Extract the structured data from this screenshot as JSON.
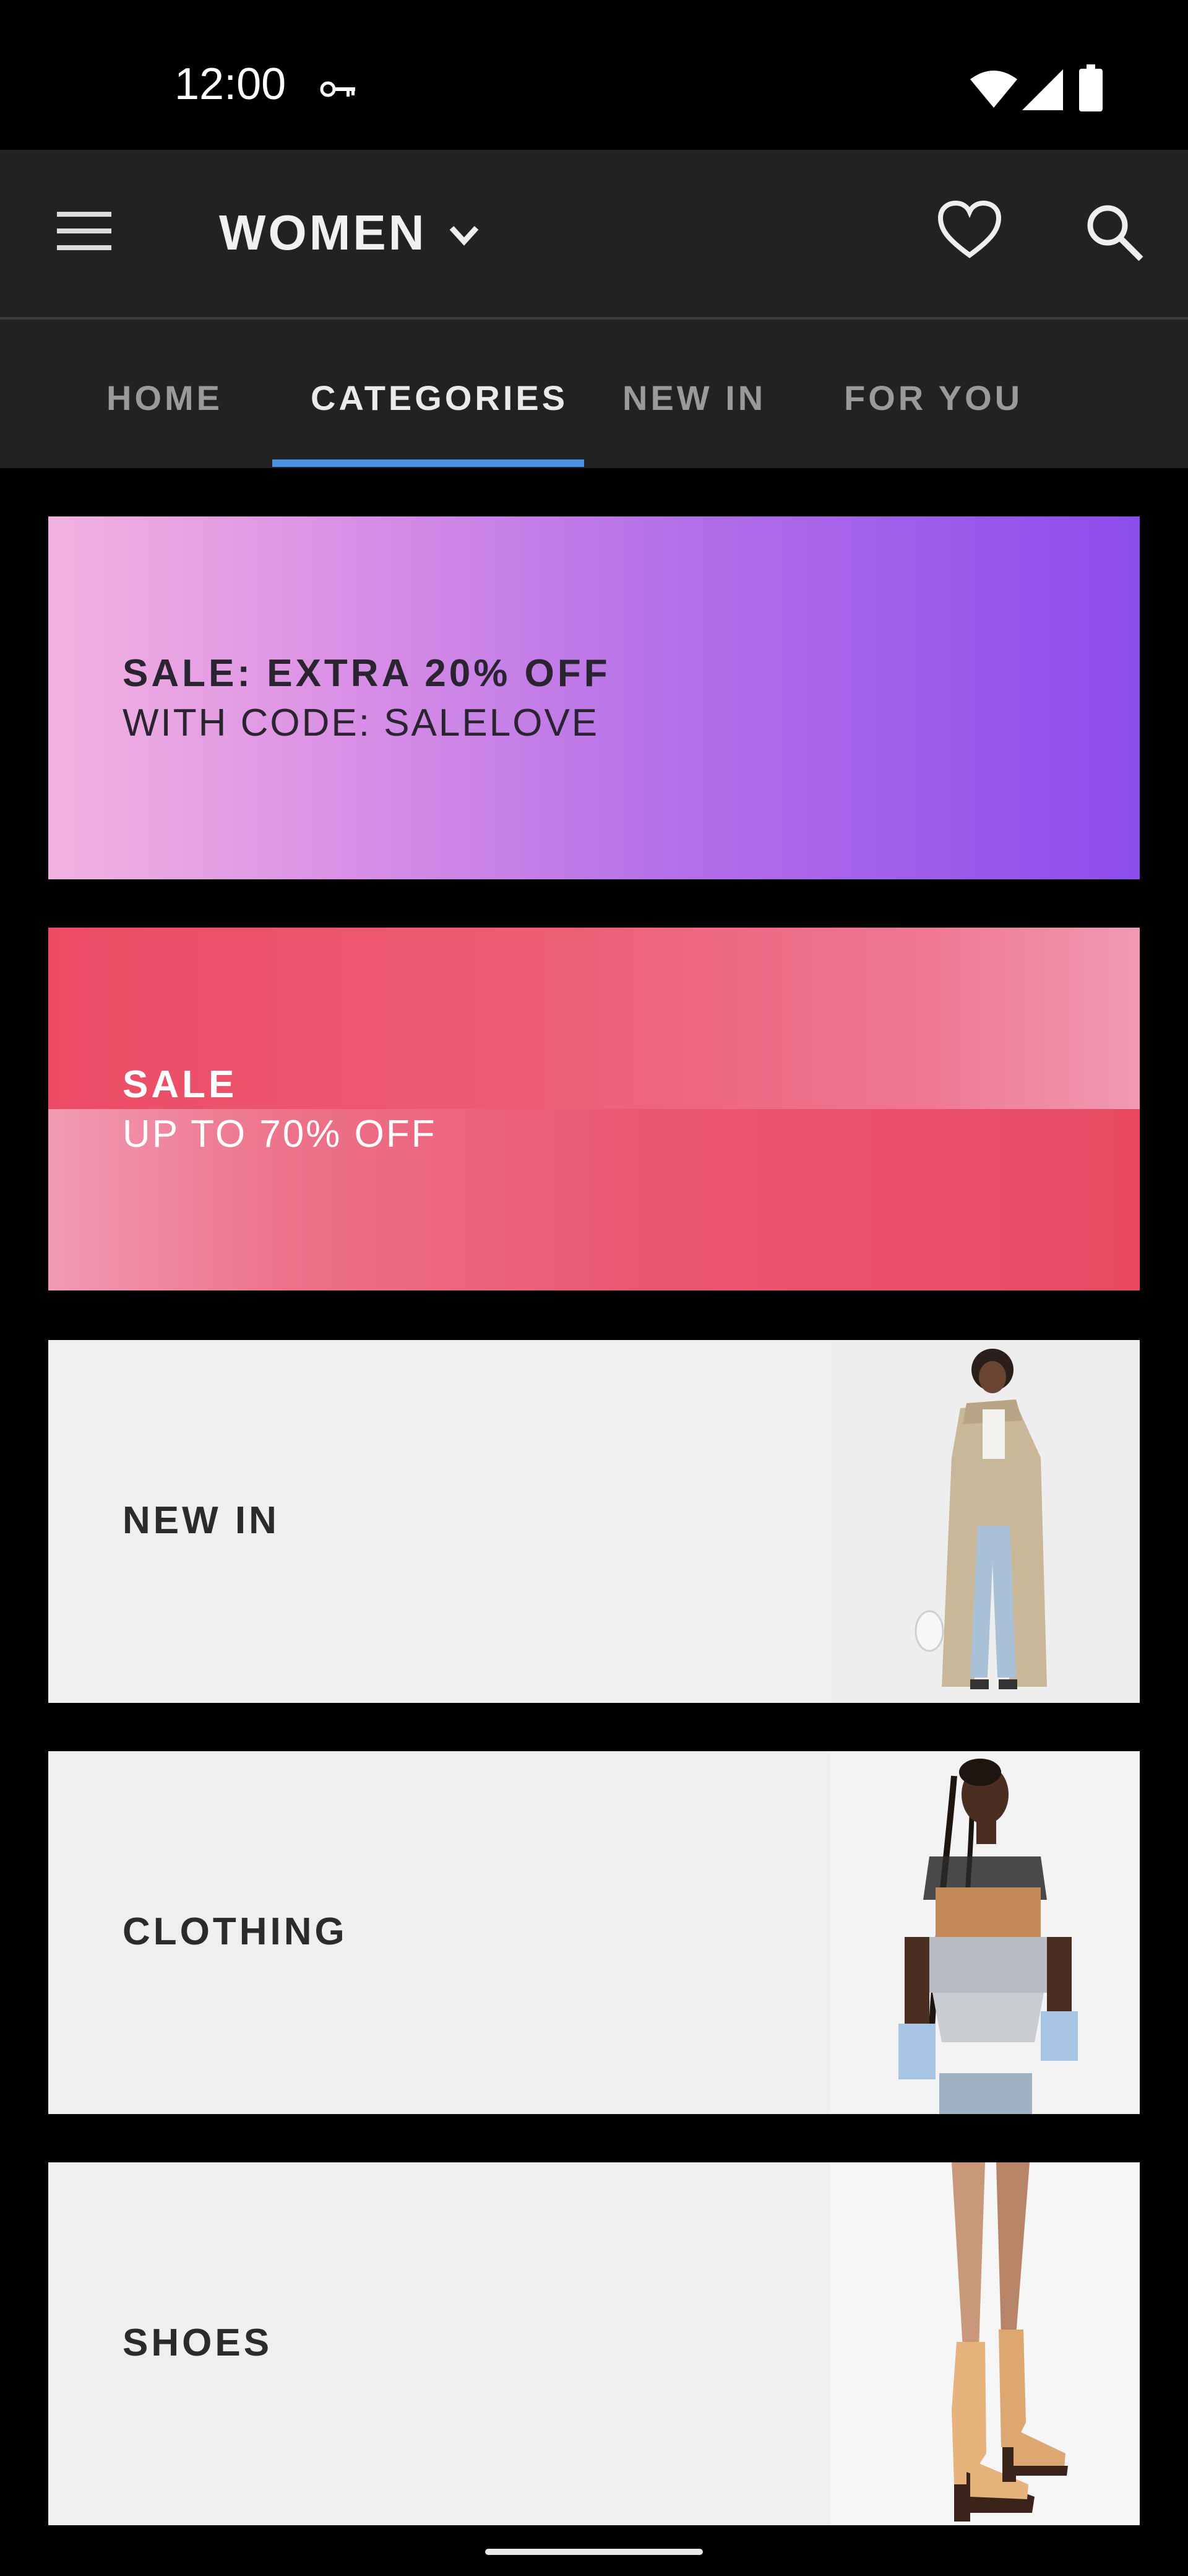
{
  "status_bar": {
    "time": "12:00",
    "icons": [
      "key-icon",
      "wifi-icon",
      "signal-icon",
      "battery-icon"
    ]
  },
  "app_bar": {
    "title": "WOMEN",
    "icons": [
      "menu-icon",
      "chevron-down-icon",
      "heart-icon",
      "search-icon"
    ]
  },
  "tabs": {
    "items": [
      {
        "label": "HOME"
      },
      {
        "label": "CATEGORIES"
      },
      {
        "label": "NEW IN"
      },
      {
        "label": "FOR YOU"
      }
    ],
    "active": "CATEGORIES",
    "indicator_color": "#4a90e2"
  },
  "promos": [
    {
      "title": "SALE: EXTRA 20% OFF",
      "subtitle": "WITH CODE: SALELOVE",
      "colors": [
        "#f2b2e0",
        "#8d4ced"
      ]
    },
    {
      "title": "SALE",
      "subtitle": "UP TO 70% OFF",
      "colors": [
        "#ec4e66",
        "#f09ab3"
      ]
    }
  ],
  "categories": [
    {
      "label": "NEW IN",
      "image": "model-in-trench-coat"
    },
    {
      "label": "CLOTHING",
      "image": "model-in-mesh-top"
    },
    {
      "label": "SHOES",
      "image": "legs-in-tan-boots"
    }
  ]
}
